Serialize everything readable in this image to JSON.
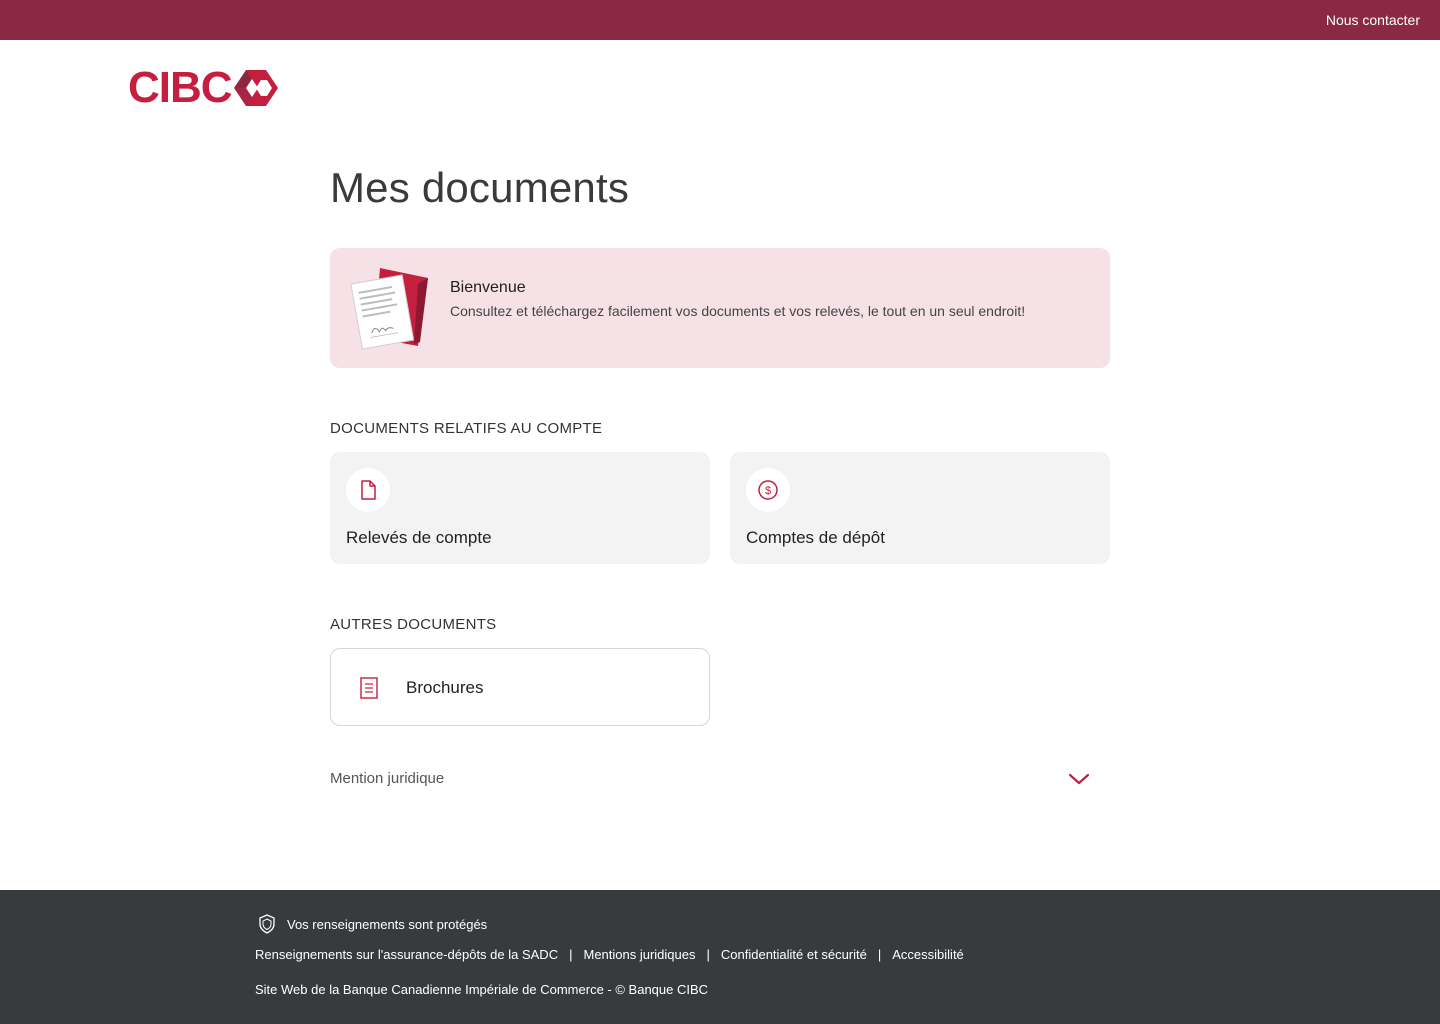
{
  "header": {
    "contact_link": "Nous contacter"
  },
  "brand": {
    "logo_text": "CIBC",
    "logo_icon": "cibc-diamond-icon",
    "color_primary": "#c41f3e",
    "color_topbar": "#8b2942"
  },
  "main": {
    "title": "Mes documents",
    "welcome": {
      "title": "Bienvenue",
      "description": "Consultez et téléchargez facilement vos documents et vos relevés, le tout en un seul endroit!",
      "illustration": "documents-illustration",
      "background": "#f5e1e6"
    },
    "account_section": {
      "title": "DOCUMENTS RELATIFS AU COMPTE",
      "cards": [
        {
          "label": "Relevés de compte",
          "icon": "document-icon"
        },
        {
          "label": "Comptes de dépôt",
          "icon": "dollar-circle-icon"
        }
      ]
    },
    "other_section": {
      "title": "AUTRES DOCUMENTS",
      "items": [
        {
          "label": "Brochures",
          "icon": "brochure-icon"
        }
      ]
    },
    "legal": {
      "label": "Mention juridique",
      "icon": "chevron-down-icon"
    }
  },
  "footer": {
    "protected_text": "Vos renseignements sont protégés",
    "protected_icon": "shield-icon",
    "links": [
      "Renseignements sur l'assurance-dépôts de la SADC",
      "Mentions juridiques",
      "Confidentialité et sécurité",
      "Accessibilité"
    ],
    "separator": "|",
    "copyright": "Site Web de la Banque Canadienne Impériale de Commerce - © Banque CIBC",
    "background": "#383b3e"
  }
}
